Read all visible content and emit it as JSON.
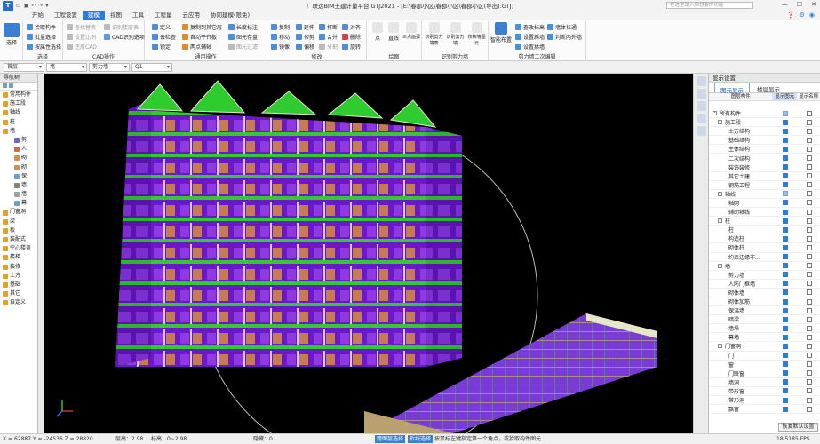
{
  "app": {
    "title": "广联达BIM土建计量平台 GTJ2021 - [E:\\春郡小区\\春郡小区\\春郡小区(导出).GTJ]",
    "logo": "T"
  },
  "menu": {
    "tabs": [
      "开始",
      "工程设置",
      "建模",
      "视图",
      "工具",
      "工程量",
      "云应用",
      "协同建模(限免)"
    ],
    "active": 2
  },
  "search": {
    "placeholder": "在这里输入你想要的功能"
  },
  "ribbon": {
    "select_label": "选择",
    "group_select": {
      "label": "选择",
      "items": [
        "拾取构件",
        "批量选择",
        "按属性选择"
      ]
    },
    "group_cad": {
      "label": "CAD操作",
      "items": [
        "查找替换",
        "设置比例",
        "还原CAD",
        "识别楼层表",
        "CAD识别选项"
      ]
    },
    "group_common": {
      "label": "通用操作",
      "items": [
        "定义",
        "云检查",
        "锁定",
        "复制到其它层",
        "自动平齐板",
        "两点辅轴",
        "长度标注",
        "图元存盘",
        "图元过滤"
      ]
    },
    "group_modify": {
      "label": "修改",
      "items": [
        "复制",
        "移动",
        "镜像",
        "延伸",
        "修剪",
        "偏移",
        "打断",
        "合并",
        "分割",
        "对齐",
        "删除",
        "旋转"
      ]
    },
    "group_draw": {
      "label": "绘图",
      "items": [
        "点",
        "直线",
        "三点画弧"
      ]
    },
    "group_recog": {
      "label": "识别剪力墙",
      "items": [
        "识别剪力墙表",
        "识别剪力墙",
        "校核墙图元"
      ]
    },
    "group_edit2": {
      "label": "剪力墙二次编辑",
      "items": [
        "智能布置",
        "查改标高",
        "设置斜墙",
        "设置拱墙",
        "墙体拉通",
        "判断内外墙"
      ]
    }
  },
  "selectors": [
    "首层",
    "墙",
    "剪力墙",
    "Q1"
  ],
  "nav": {
    "title": "导航树",
    "items": [
      {
        "label": "常用构件",
        "color": "#e0a030",
        "indent": 0
      },
      {
        "label": "施工段",
        "color": "#e0a030",
        "indent": 0
      },
      {
        "label": "轴线",
        "color": "#e0a030",
        "indent": 0
      },
      {
        "label": "柱",
        "color": "#e0a030",
        "indent": 0
      },
      {
        "label": "墙",
        "color": "#e0a030",
        "indent": 0
      },
      {
        "label": "剪",
        "color": "#7b5fc9",
        "indent": 1
      },
      {
        "label": "人",
        "color": "#c9703a",
        "indent": 1
      },
      {
        "label": "砌",
        "color": "#d09050",
        "indent": 1
      },
      {
        "label": "砌",
        "color": "#d09050",
        "indent": 1
      },
      {
        "label": "保",
        "color": "#6aa0d0",
        "indent": 1
      },
      {
        "label": "墙",
        "color": "#808080",
        "indent": 1
      },
      {
        "label": "墙",
        "color": "#a0a0a0",
        "indent": 1
      },
      {
        "label": "幕",
        "color": "#70a0c0",
        "indent": 1
      },
      {
        "label": "门窗洞",
        "color": "#e0a030",
        "indent": 0
      },
      {
        "label": "梁",
        "color": "#e0a030",
        "indent": 0
      },
      {
        "label": "板",
        "color": "#e0a030",
        "indent": 0
      },
      {
        "label": "装配式",
        "color": "#e0a030",
        "indent": 0
      },
      {
        "label": "空心楼盖",
        "color": "#e0a030",
        "indent": 0
      },
      {
        "label": "楼梯",
        "color": "#e0a030",
        "indent": 0
      },
      {
        "label": "装修",
        "color": "#e0a030",
        "indent": 0
      },
      {
        "label": "土方",
        "color": "#e0a030",
        "indent": 0
      },
      {
        "label": "基础",
        "color": "#e0a030",
        "indent": 0
      },
      {
        "label": "其它",
        "color": "#e0a030",
        "indent": 0
      },
      {
        "label": "自定义",
        "color": "#e0a030",
        "indent": 0
      }
    ]
  },
  "panel": {
    "title": "显示设置",
    "tabs": [
      "图元显示",
      "楼层显示"
    ],
    "columns": [
      "图层构件",
      "显示图元",
      "显示名称"
    ],
    "rows": [
      {
        "label": "所有构件",
        "level": 0,
        "expander": "-",
        "show": "half",
        "name": "off"
      },
      {
        "label": "施工段",
        "level": 1,
        "expander": "-",
        "show": "on",
        "name": "off"
      },
      {
        "label": "土方结构",
        "level": 2,
        "show": "on",
        "name": "off"
      },
      {
        "label": "基础结构",
        "level": 2,
        "show": "on",
        "name": "off"
      },
      {
        "label": "主体结构",
        "level": 2,
        "show": "on",
        "name": "off"
      },
      {
        "label": "二次结构",
        "level": 2,
        "show": "on",
        "name": "off"
      },
      {
        "label": "装饰装修",
        "level": 2,
        "show": "on",
        "name": "off"
      },
      {
        "label": "其它土建",
        "level": 2,
        "show": "on",
        "name": "off"
      },
      {
        "label": "钢筋工程",
        "level": 2,
        "show": "on",
        "name": "off"
      },
      {
        "label": "轴线",
        "level": 1,
        "expander": "-",
        "show": "half",
        "name": "off"
      },
      {
        "label": "轴网",
        "level": 2,
        "show": "on",
        "name": "off"
      },
      {
        "label": "辅助轴线",
        "level": 2,
        "show": "on",
        "name": "off"
      },
      {
        "label": "柱",
        "level": 1,
        "expander": "-",
        "show": "on",
        "name": "off"
      },
      {
        "label": "柱",
        "level": 2,
        "show": "on",
        "name": "off"
      },
      {
        "label": "构造柱",
        "level": 2,
        "show": "on",
        "name": "off"
      },
      {
        "label": "砌体柱",
        "level": 2,
        "show": "on",
        "name": "off"
      },
      {
        "label": "约束边缘非...",
        "level": 2,
        "show": "on",
        "name": "off"
      },
      {
        "label": "墙",
        "level": 1,
        "expander": "-",
        "show": "on",
        "name": "off"
      },
      {
        "label": "剪力墙",
        "level": 2,
        "show": "on",
        "name": "off"
      },
      {
        "label": "人防门框墙",
        "level": 2,
        "show": "on",
        "name": "off"
      },
      {
        "label": "砌体墙",
        "level": 2,
        "show": "on",
        "name": "off"
      },
      {
        "label": "砌体加筋",
        "level": 2,
        "show": "on",
        "name": "off"
      },
      {
        "label": "保温墙",
        "level": 2,
        "show": "on",
        "name": "off"
      },
      {
        "label": "暗梁",
        "level": 2,
        "show": "on",
        "name": "off"
      },
      {
        "label": "墙垛",
        "level": 2,
        "show": "on",
        "name": "off"
      },
      {
        "label": "幕墙",
        "level": 2,
        "show": "on",
        "name": "off"
      },
      {
        "label": "门窗洞",
        "level": 1,
        "expander": "-",
        "show": "on",
        "name": "off"
      },
      {
        "label": "门",
        "level": 2,
        "show": "on",
        "name": "off"
      },
      {
        "label": "窗",
        "level": 2,
        "show": "on",
        "name": "off"
      },
      {
        "label": "门联窗",
        "level": 2,
        "show": "on",
        "name": "off"
      },
      {
        "label": "墙洞",
        "level": 2,
        "show": "on",
        "name": "off"
      },
      {
        "label": "带形窗",
        "level": 2,
        "show": "on",
        "name": "off"
      },
      {
        "label": "带形洞",
        "level": 2,
        "show": "on",
        "name": "off"
      },
      {
        "label": "飘窗",
        "level": 2,
        "show": "on",
        "name": "off"
      }
    ],
    "restore_button": "恢复默认设置"
  },
  "status": {
    "coords": "X = 62887 Y = -24536 Z = 28820",
    "floor_height": "层高：2.98",
    "elevation": "标高：0~2.98",
    "hidden": "隐藏：0",
    "cross_select": "跨图层选择",
    "polyline_select": "折线选择",
    "hint": "按鼠标左键指定第一个角点，或拾取构件图元",
    "fps": "18.5185 FPS"
  },
  "colors": {
    "accent": "#2e7bd8",
    "wall": "#8a2be2",
    "slab": "#2fcc2f",
    "beam": "#e6e6c8"
  }
}
